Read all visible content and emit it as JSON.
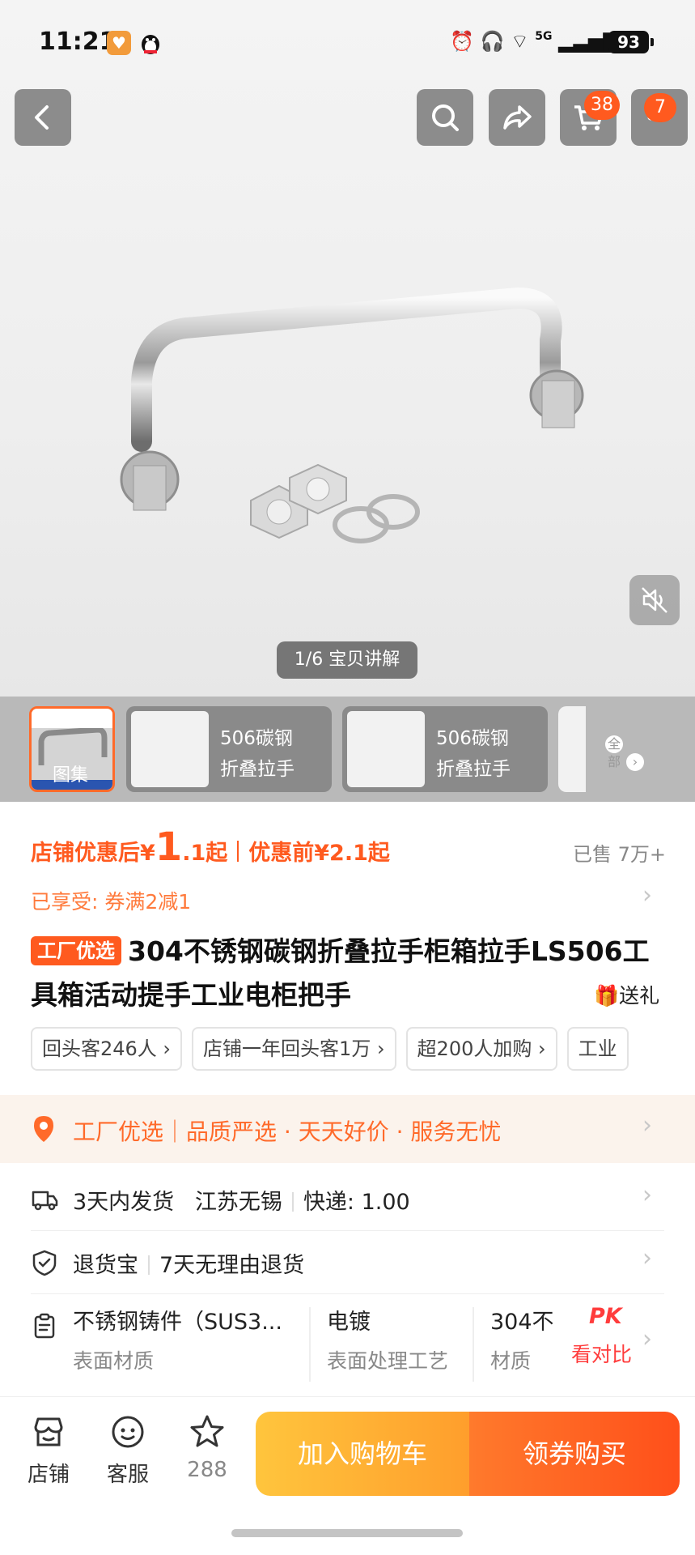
{
  "status_bar": {
    "time": "11:21",
    "battery": "93",
    "network": "5G"
  },
  "header": {
    "cart_count": "38",
    "more_count": "7"
  },
  "gallery": {
    "counter": "1/6 宝贝讲解",
    "thumb_first_label": "图集",
    "thumbs": [
      {
        "line1": "506碳钢",
        "line2": "折叠拉手"
      },
      {
        "line1": "506碳钢",
        "line2": "折叠拉手"
      }
    ],
    "all_label": "全部"
  },
  "price": {
    "after_label": "店铺优惠后¥",
    "after_value": "1",
    "after_suffix": ".1起",
    "before": "优惠前¥2.1起",
    "sold": "已售 7万+"
  },
  "coupon": {
    "text": "已享受: 券满2减1"
  },
  "product": {
    "tag": "工厂优选",
    "title": "304不锈钢碳钢折叠拉手柜箱拉手LS506工具箱活动提手工业电柜把手",
    "gift": "送礼"
  },
  "chips": [
    "回头客246人 ›",
    "店铺一年回头客1万 ›",
    "超200人加购 ›",
    "工业"
  ],
  "banner": {
    "text": "工厂优选｜品质严选 · 天天好价 · 服务无忧"
  },
  "shipping": {
    "days": "3天内发货",
    "origin": "江苏无锡",
    "express": "快递: 1.00"
  },
  "returns": {
    "name": "退货宝",
    "policy": "7天无理由退货"
  },
  "attributes": [
    {
      "value": "不锈钢铸件（SUS3...",
      "key": "表面材质"
    },
    {
      "value": "电镀",
      "key": "表面处理工艺"
    },
    {
      "value": "304不",
      "key": "材质"
    }
  ],
  "compare": {
    "pk": "PK",
    "label": "看对比"
  },
  "tabbar": {
    "shop": "店铺",
    "service": "客服",
    "fav_count": "288",
    "add_cart": "加入购物车",
    "buy": "领券购买"
  }
}
